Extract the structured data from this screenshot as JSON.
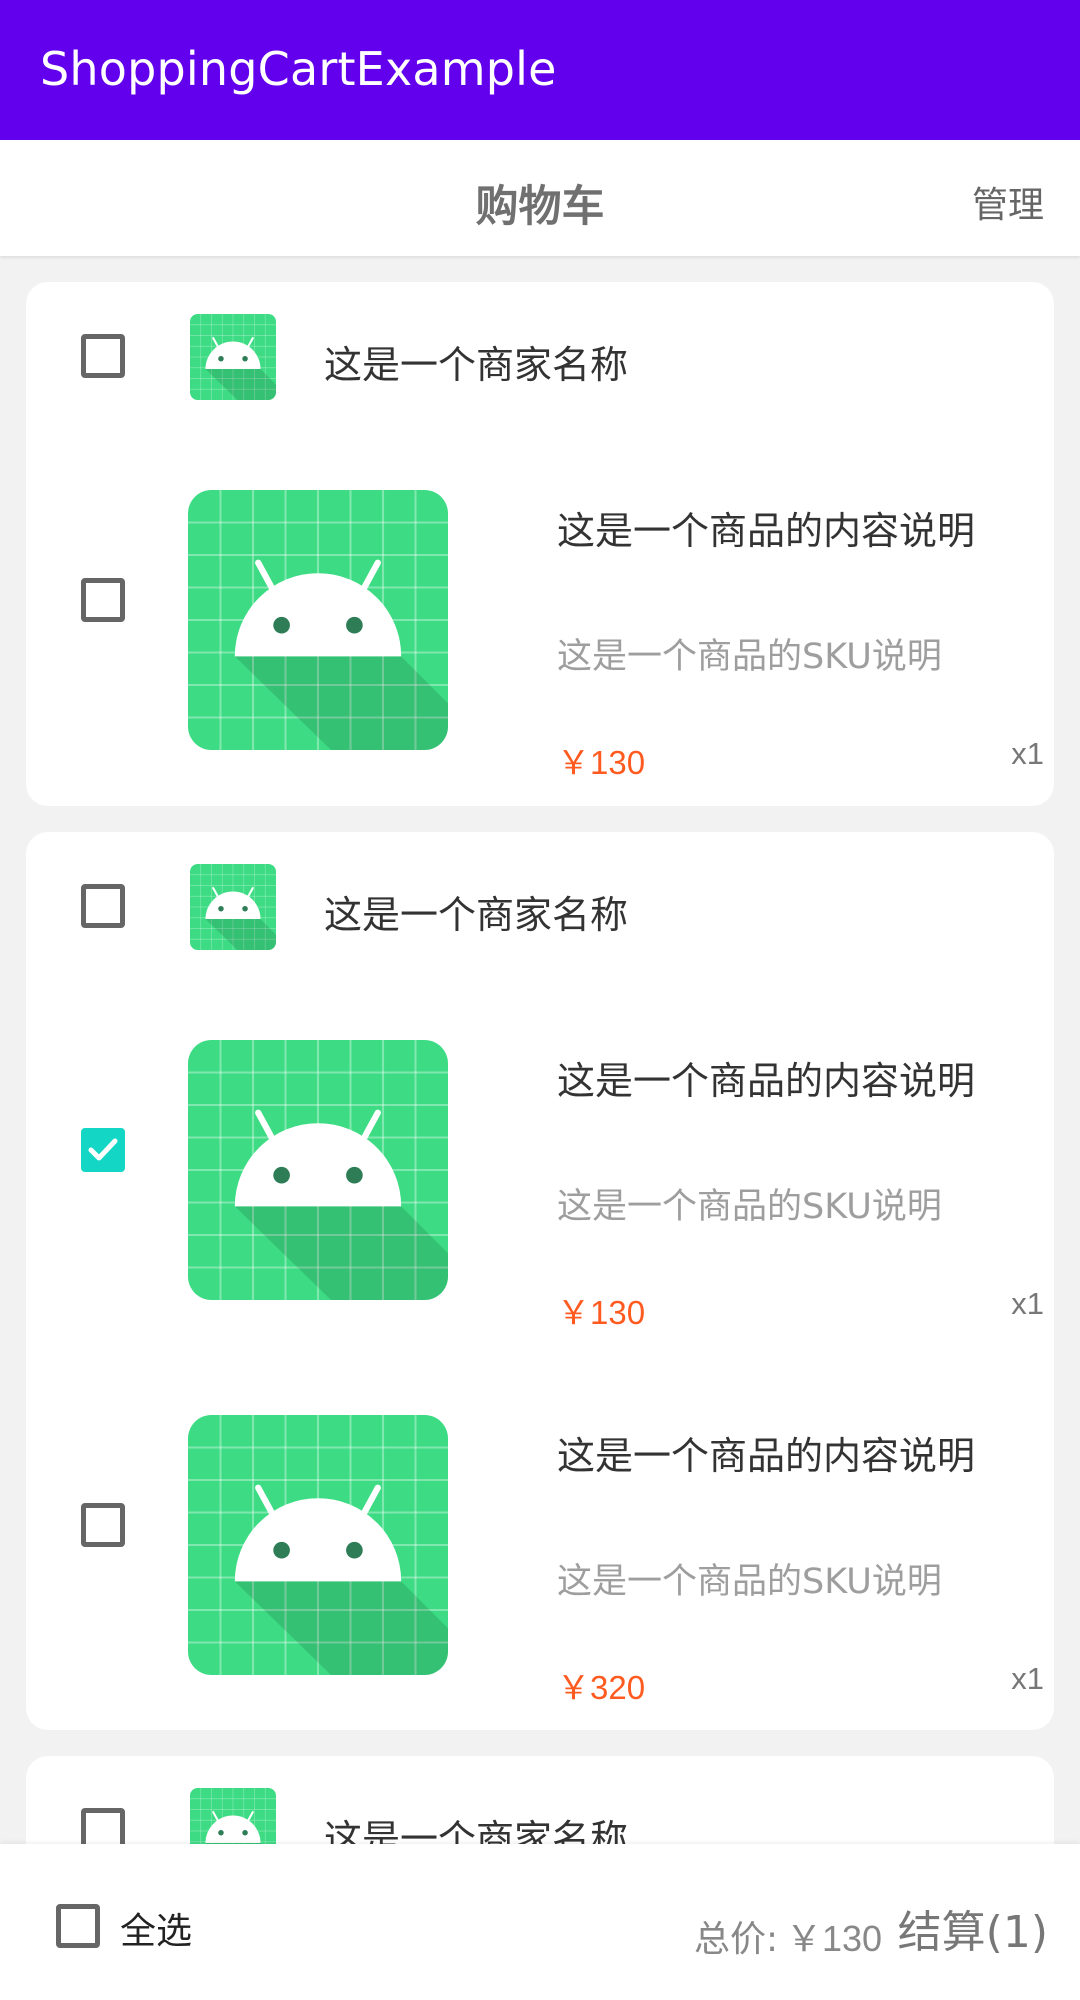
{
  "app": {
    "title": "ShoppingCartExample",
    "accent_color": "#6200ee"
  },
  "header": {
    "title": "购物车",
    "manage_label": "管理"
  },
  "shops": [
    {
      "name": "这是一个商家名称",
      "checked": false,
      "icon": "android-icon",
      "products": [
        {
          "title": "这是一个商品的内容说明",
          "sku": "这是一个商品的SKU说明",
          "price": "￥130",
          "qty": "x1",
          "checked": false,
          "image": "android-icon"
        }
      ]
    },
    {
      "name": "这是一个商家名称",
      "checked": false,
      "icon": "android-icon",
      "products": [
        {
          "title": "这是一个商品的内容说明",
          "sku": "这是一个商品的SKU说明",
          "price": "￥130",
          "qty": "x1",
          "checked": true,
          "image": "android-icon"
        },
        {
          "title": "这是一个商品的内容说明",
          "sku": "这是一个商品的SKU说明",
          "price": "￥320",
          "qty": "x1",
          "checked": false,
          "image": "android-icon"
        }
      ]
    },
    {
      "name": "这是一个商家名称",
      "checked": false,
      "icon": "android-icon",
      "products": []
    }
  ],
  "footer": {
    "select_all_label": "全选",
    "select_all_checked": false,
    "total_label": "总价:",
    "total_amount": "￥130",
    "checkout_label": "结算(1)"
  },
  "colors": {
    "price": "#ff5a1f",
    "checked": "#14d6c4",
    "icon_green": "#3ddc84"
  }
}
